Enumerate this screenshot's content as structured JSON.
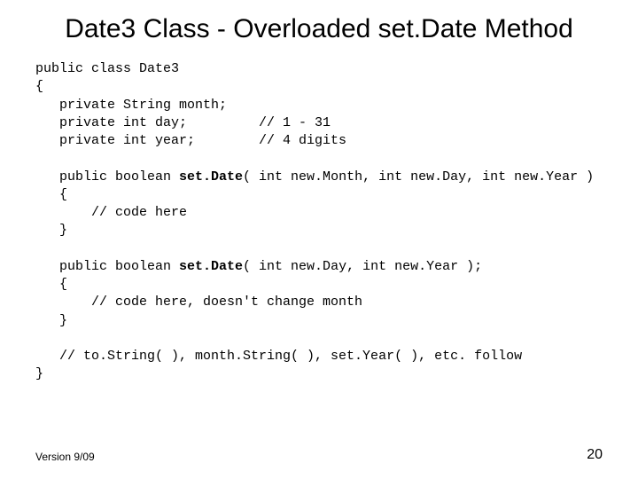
{
  "title": "Date3 Class - Overloaded set.Date Method",
  "code": {
    "l1": "public class Date3",
    "l2": "{",
    "l3": "   private String month;",
    "l4": "   private int day;         // 1 - 31",
    "l5": "   private int year;        // 4 digits",
    "l6": "",
    "l7a": "   public boolean ",
    "l7b": "set.Date",
    "l7c": "( int new.Month, int new.Day, int new.Year )",
    "l8": "   {",
    "l9": "       // code here",
    "l10": "   }",
    "l11": "",
    "l12a": "   public boolean ",
    "l12b": "set.Date",
    "l12c": "( int new.Day, int new.Year );",
    "l13": "   {",
    "l14": "       // code here, doesn't change month",
    "l15": "   }",
    "l16": "",
    "l17": "   // to.String( ), month.String( ), set.Year( ), etc. follow",
    "l18": "}"
  },
  "footer": {
    "version": "Version 9/09",
    "page": "20"
  }
}
